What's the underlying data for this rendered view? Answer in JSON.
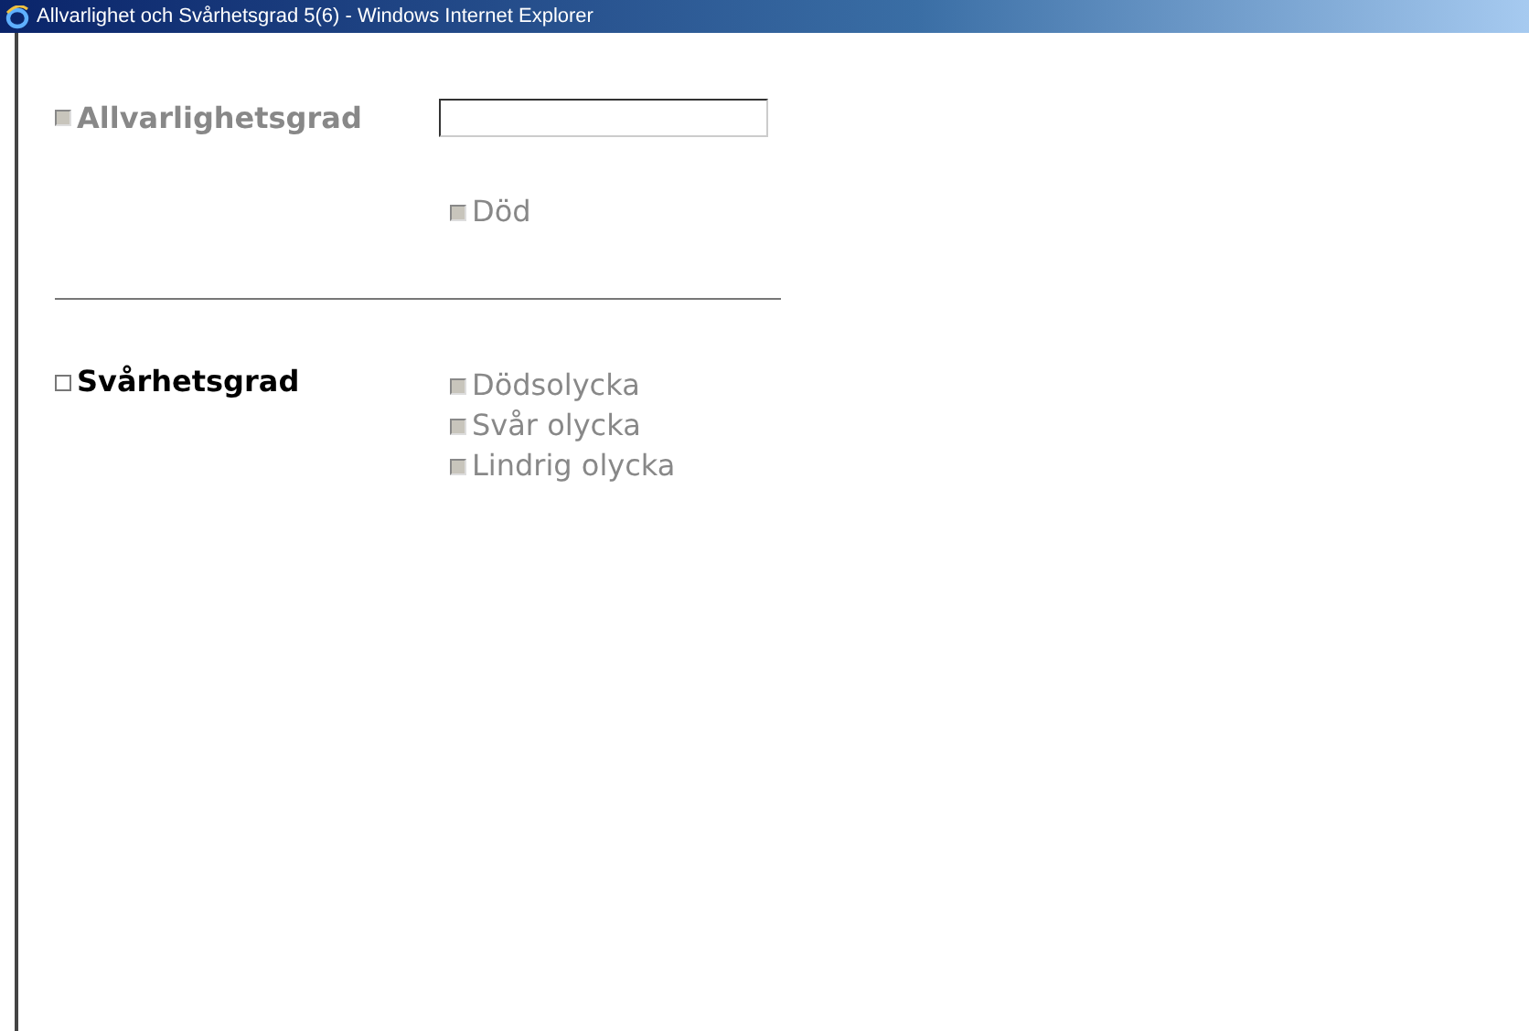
{
  "window": {
    "title": "Allvarlighet och Svårhetsgrad 5(6) - Windows Internet Explorer"
  },
  "severity": {
    "label": "Allvarlighetsgrad",
    "checked": false,
    "disabled": true,
    "options": [
      {
        "label": "Död",
        "checked": false,
        "disabled": true
      }
    ]
  },
  "difficulty": {
    "label": "Svårhetsgrad",
    "checked": false,
    "disabled": false,
    "options": [
      {
        "label": "Dödsolycka",
        "checked": false,
        "disabled": true
      },
      {
        "label": "Svår olycka",
        "checked": false,
        "disabled": true
      },
      {
        "label": "Lindrig olycka",
        "checked": false,
        "disabled": true
      }
    ]
  }
}
